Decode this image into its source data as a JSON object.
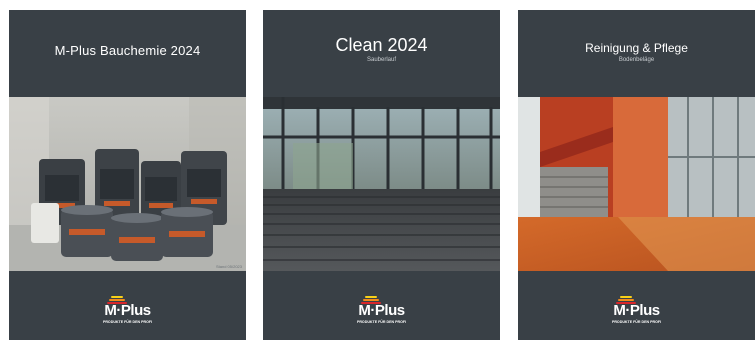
{
  "catalogs": [
    {
      "title": "M-Plus Bauchemie 2024",
      "subtitle": "",
      "stand": "Stand 05/2023"
    },
    {
      "title": "Clean 2024",
      "subtitle": "Sauberlauf"
    },
    {
      "title": "Reinigung & Pflege",
      "subtitle": "Bodenbeläge"
    }
  ],
  "brand": {
    "name": "M·Plus",
    "tagline": "PRODUKTE FÜR DEN PROFI",
    "colors": {
      "red": "#d9262b",
      "orange": "#f28c1a",
      "yellow": "#f7d117"
    }
  },
  "colors": {
    "cover_bg": "#394046",
    "page_bg": "#ffffff"
  }
}
